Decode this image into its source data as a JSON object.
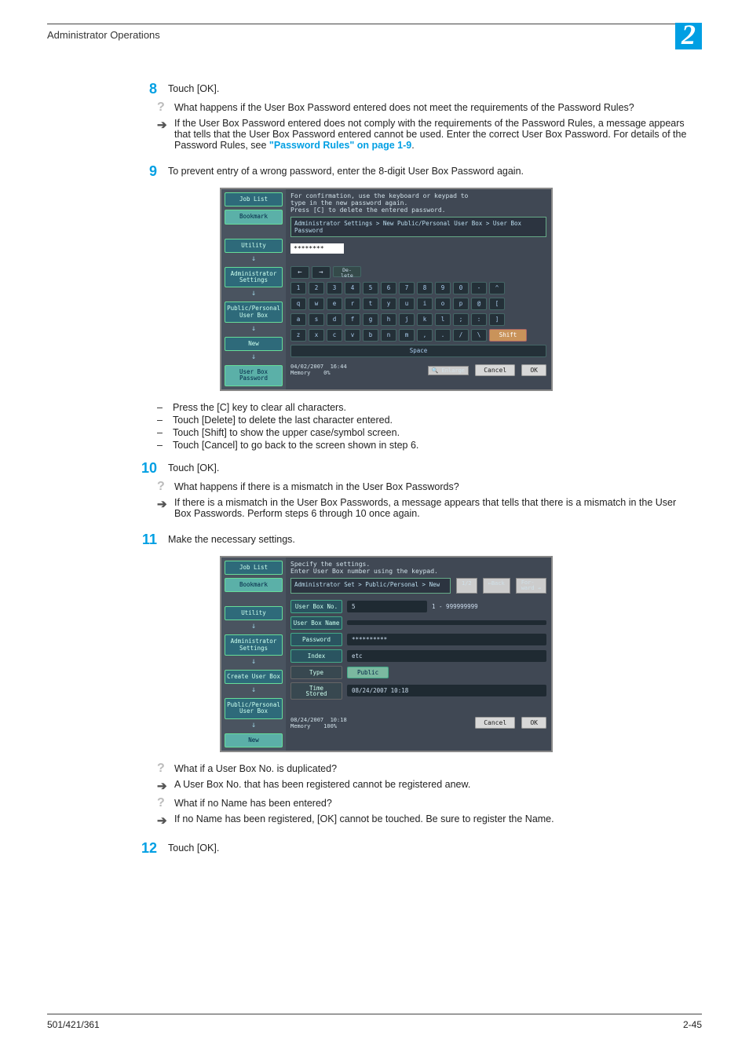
{
  "header": {
    "section": "Administrator Operations",
    "chapter": "2"
  },
  "steps": {
    "s8": {
      "num": "8",
      "text": "Touch [OK].",
      "q": "What happens if the User Box Password entered does not meet the requirements of the Password Rules?",
      "a_pre": "If the User Box Password entered does not comply with the requirements of the Password Rules, a message appears that tells that the User Box Password entered cannot be used. Enter the correct User Box Password. For details of the Password Rules, see ",
      "a_link": "\"Password Rules\" on page 1-9",
      "a_post": "."
    },
    "s9": {
      "num": "9",
      "text": "To prevent entry of a wrong password, enter the 8-digit User Box Password again.",
      "bullets": [
        "Press the [C] key to clear all characters.",
        "Touch [Delete] to delete the last character entered.",
        "Touch [Shift] to show the upper case/symbol screen.",
        "Touch [Cancel] to go back to the screen shown in step 6."
      ]
    },
    "s10": {
      "num": "10",
      "text": "Touch [OK].",
      "q": "What happens if there is a mismatch in the User Box Passwords?",
      "a": "If there is a mismatch in the User Box Passwords, a message appears that tells that there is a mismatch in the User Box Passwords. Perform steps 6 through 10 once again."
    },
    "s11": {
      "num": "11",
      "text": "Make the necessary settings.",
      "q1": "What if a User Box No. is duplicated?",
      "a1": "A User Box No. that has been registered cannot be registered anew.",
      "q2": "What if no Name has been entered?",
      "a2": "If no Name has been registered, [OK] cannot be touched. Be sure to register the Name."
    },
    "s12": {
      "num": "12",
      "text": "Touch [OK]."
    }
  },
  "screen1": {
    "side": {
      "job_list": "Job List",
      "bookmark": "Bookmark",
      "utility": "Utility",
      "admin": "Administrator\nSettings",
      "pub": "Public/Personal\nUser Box",
      "new": "New",
      "ubp": "User Box\nPassword"
    },
    "msg1": "For confirmation, use the keyboard or keypad to",
    "msg2": "type in the new password again.",
    "msg3": "Press [C] to delete the entered password.",
    "crumb": "Administrator Settings > New Public/Personal User Box > User Box Password",
    "field": "********",
    "rows": {
      "r1": [
        "1",
        "2",
        "3",
        "4",
        "5",
        "6",
        "7",
        "8",
        "9",
        "0",
        "-",
        "^"
      ],
      "r2": [
        "q",
        "w",
        "e",
        "r",
        "t",
        "y",
        "u",
        "i",
        "o",
        "p",
        "@",
        "["
      ],
      "r3": [
        "a",
        "s",
        "d",
        "f",
        "g",
        "h",
        "j",
        "k",
        "l",
        ";",
        ":",
        "]"
      ],
      "r4": [
        "z",
        "x",
        "c",
        "v",
        "b",
        "n",
        "m",
        ",",
        ".",
        "/",
        "\\"
      ]
    },
    "shift": "Shift",
    "space": "Space",
    "delete": "De-\nlete",
    "enlarge": "Enlarge",
    "cancel": "Cancel",
    "ok": "OK",
    "date": "04/02/2007",
    "time": "16:44",
    "mem": "Memory",
    "mempct": "0%"
  },
  "screen2": {
    "side": {
      "job_list": "Job List",
      "bookmark": "Bookmark",
      "utility": "Utility",
      "admin": "Administrator\nSettings",
      "create": "Create User Box",
      "pub": "Public/Personal\nUser Box",
      "new": "New"
    },
    "msg1": "Specify the settings.",
    "msg2": "Enter User Box number using the keypad.",
    "crumb": "Administrator Set > Public/Personal > New",
    "page": "1/2",
    "back": "←Back",
    "fwd": "For-\nward →",
    "rows": {
      "boxno_l": "User Box No.",
      "boxno_v": "5",
      "boxno_range": "1 - 999999999",
      "name_l": "User Box Name",
      "pwd_l": "Password",
      "pwd_v": "**********",
      "idx_l": "Index",
      "idx_v": "etc",
      "type_l": "Type",
      "type_v": "Public",
      "time_l": "Time\nStored",
      "time_v": "08/24/2007  10:18"
    },
    "cancel": "Cancel",
    "ok": "OK",
    "date": "08/24/2007",
    "time": "10:18",
    "mem": "Memory",
    "mempct": "100%"
  },
  "footer": {
    "left": "501/421/361",
    "right": "2-45"
  }
}
